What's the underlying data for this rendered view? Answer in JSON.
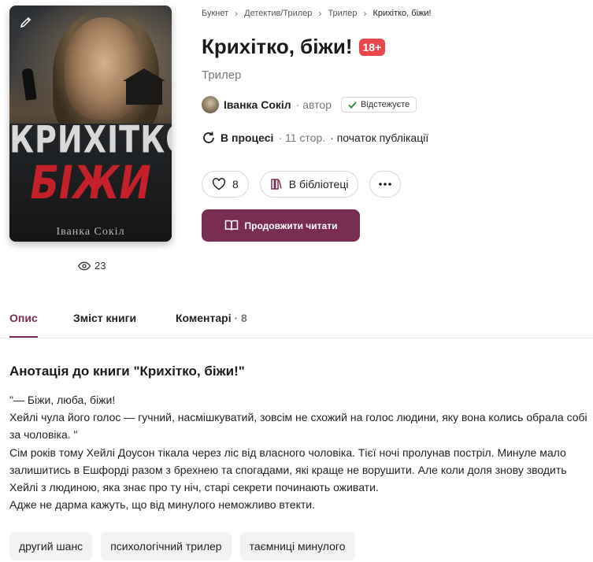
{
  "breadcrumbs": [
    "Букнет",
    "Детектив/Трилер",
    "Трилер",
    "Крихітко, біжи!"
  ],
  "book": {
    "title": "Крихітко, біжи!",
    "age_badge": "18+",
    "genre": "Трилер",
    "cover": {
      "title_line1": "КРИХІТКО,",
      "title_line2": "БІЖИ",
      "author": "Іванка Сокіл"
    },
    "views": "23"
  },
  "author": {
    "name": "Іванка Сокіл",
    "role": "· автор",
    "follow_label": "Відстежуєте"
  },
  "status": {
    "label": "В процесі",
    "pages": "· 11 стор.",
    "publication": "· початок публікації"
  },
  "actions": {
    "likes": "8",
    "library_label": "В бібліотеці",
    "read_label": "Продовжити читати"
  },
  "tabs": [
    {
      "label": "Опис"
    },
    {
      "label": "Зміст книги"
    },
    {
      "label": "Коментарі",
      "count": "· 8"
    }
  ],
  "annotation": {
    "title": "Анотація до книги \"Крихітко, біжи!\"",
    "lines": [
      "\"— Біжи, люба, біжи!",
      "Хейлі чула його голос — гучний, насмішкуватий, зовсім не схожий на голос людини, яку вона колись обрала собі за чоловіка. \"",
      "Сім років тому Хейлі Доусон тікала через ліс від власного чоловіка. Тієї ночі пролунав постріл. Минуле мало залишитись в Ешфорді разом з брехнею та спогадами, які краще не ворушити. Але коли доля знову зводить Хейлі з людиною, яка знає про ту ніч, старі секрети починають оживати.",
      "Адже не дарма кажуть, що від минулого неможливо втекти."
    ]
  },
  "tags": [
    "другий шанс",
    "психологічний трилер",
    "таємниці минулого"
  ],
  "colors": {
    "accent": "#7a2d53",
    "badge": "#e8474b",
    "follow_check": "#2e8b3d"
  }
}
